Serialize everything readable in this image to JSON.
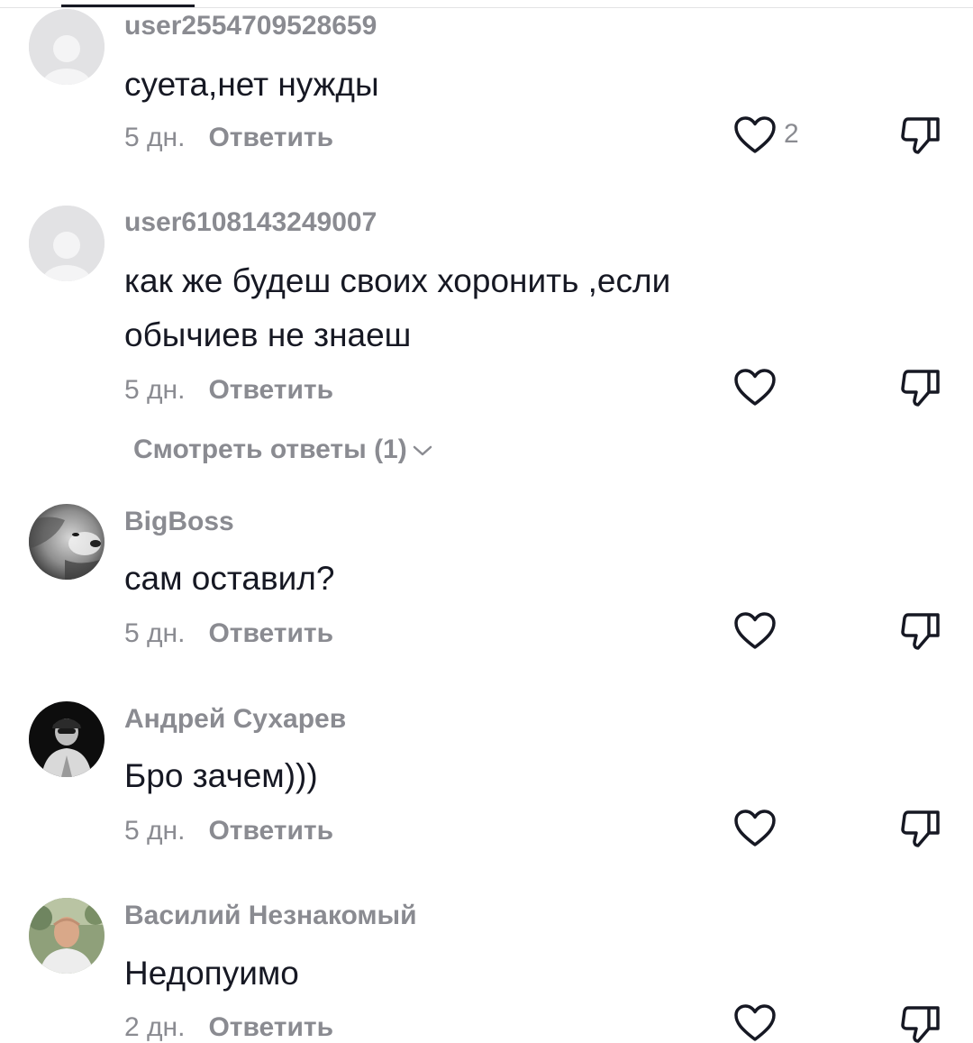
{
  "comments": [
    {
      "username": "user2554709528659",
      "text": "суета,нет нужды",
      "time": "5 дн.",
      "reply_label": "Ответить",
      "likes": "2",
      "avatar": "default-user-icon"
    },
    {
      "username": "user6108143249007",
      "text": "как же будеш своих хоронить ,если обычиев не знаеш",
      "time": "5 дн.",
      "reply_label": "Ответить",
      "avatar": "default-user-icon",
      "view_replies_label": "Смотреть ответы (1)"
    },
    {
      "username": "BigBoss",
      "text": "сам оставил?",
      "time": "5 дн.",
      "reply_label": "Ответить",
      "avatar": "lion-photo"
    },
    {
      "username": "Андрей Сухарев",
      "text": "Бро зачем)))",
      "time": "5 дн.",
      "reply_label": "Ответить",
      "avatar": "man-in-cap-photo"
    },
    {
      "username": "Василий Незнакомый",
      "text": "Недопуимо",
      "time": "2 дн.",
      "reply_label": "Ответить",
      "avatar": "man-outdoor-photo"
    }
  ],
  "icons": {
    "like": "heart-outline-icon",
    "dislike": "thumbs-down-icon",
    "expand": "chevron-down-icon"
  },
  "colors": {
    "text_primary": "#161823",
    "text_secondary": "#8a8b91",
    "divider": "#e3e3e4"
  }
}
